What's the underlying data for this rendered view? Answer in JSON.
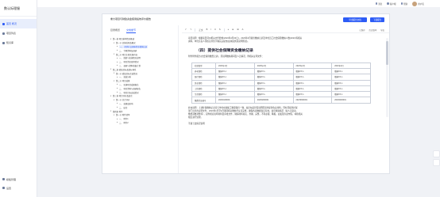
{
  "app": {
    "title": "数认标理服"
  },
  "sidebar": {
    "items": [
      {
        "label": "首页 概况"
      },
      {
        "label": "项目列表"
      },
      {
        "label": "知识库"
      }
    ],
    "bottom": [
      {
        "label": "模板管理"
      },
      {
        "label": "设置"
      }
    ]
  },
  "topbar": {
    "items": [
      "消息",
      "客户端",
      "帮助"
    ],
    "user": "用户名"
  },
  "window": {
    "title": "重大项目与财政资金使用绩效评价报告",
    "primary_button": "导出报告文档",
    "secondary_button": "下载报告"
  },
  "left_tabs": [
    "目录概览",
    "文档章节"
  ],
  "outline": [
    {
      "label": "第一章 项目基本情况概述",
      "level": 0,
      "caret": "▾"
    },
    {
      "label": "第一节 实施背景及概况",
      "level": 1,
      "caret": "▾"
    },
    {
      "label": "一、 提供社会保障资金缴纳记录",
      "level": 2,
      "caret": "▸",
      "selected": true
    },
    {
      "label": "二、 专题资料及调研",
      "level": 2,
      "caret": "▸"
    },
    {
      "label": "第二节 项目主要实施内容",
      "level": 1,
      "caret": "▾"
    },
    {
      "label": "一、 组织与实施情况说明",
      "level": 2,
      "caret": "▸"
    },
    {
      "label": "二、 项目资金使用情况",
      "level": 2,
      "caret": "▸"
    },
    {
      "label": "三、 调研与资料收集计划",
      "level": 2,
      "caret": "▸"
    },
    {
      "label": "第二章 绩效目标及指标体系",
      "level": 0,
      "caret": "▾"
    },
    {
      "label": "第一节 绩效目标完成情况",
      "level": 1,
      "caret": "▾"
    },
    {
      "label": "一、 效益分析",
      "level": 2,
      "caret": "▸"
    },
    {
      "label": "第二节 项目成果",
      "level": 1,
      "caret": "▾"
    },
    {
      "label": "一、 实施项目成果报告",
      "level": 2,
      "caret": "▸"
    },
    {
      "label": "二、 项目资料与调研报告",
      "level": 2,
      "caret": "▸"
    },
    {
      "label": "三、 项目目标达成情况",
      "level": 2,
      "caret": "▸"
    },
    {
      "label": "第三章 项目评价及结论",
      "level": 0,
      "caret": "▾"
    },
    {
      "label": "第一节 综合评价",
      "level": 1,
      "caret": "▾"
    },
    {
      "label": "一、 效果及影响",
      "level": 2,
      "caret": "▸"
    },
    {
      "label": "二、 结论",
      "level": 2,
      "caret": "▸"
    },
    {
      "label": "第四章 附件",
      "level": 0,
      "caret": "▾"
    },
    {
      "label": "第一节 附件清单",
      "level": 1,
      "caret": "▾"
    },
    {
      "label": "一、 附件1",
      "level": 2,
      "caret": "▸"
    },
    {
      "label": "二、 附件2",
      "level": 2,
      "caret": "▸"
    }
  ],
  "editor_toolbar": {
    "items": [
      "↶",
      "↷",
      "正文",
      "B",
      "I",
      "U",
      "S",
      "≡",
      "☰",
      "⊞",
      "A"
    ],
    "right": [
      "已保存",
      "历史版本",
      "导出"
    ]
  },
  "document": {
    "intro_lines": [
      "项目说明：根据项目评价相关文件要求(2023年4月20日)，2023年4月提供缴纳记录及单位员工社会保障缴纳人数(2023)等相关",
      "资料，单位负责人须核实并签字确认后提交(如未提供需说明原因)。"
    ],
    "heading": "（四）提供社会保障资金缴纳记录",
    "subline": "附件附件报告(社会保险缴费记录)，须说明缴纳期间及人员情况，附相关证明文件：",
    "table_header": [
      "社保类型",
      "2023年1月",
      "2023年2月",
      "2023年3月",
      "2023年4月"
    ],
    "table_rows": [
      [
        "养老保险",
        "缴纳XX人",
        "缴纳XX人",
        "缴纳XX人",
        "缴纳XX人"
      ],
      [
        "医疗保险",
        "缴纳XX人",
        "缴纳XX人",
        "缴纳XX人",
        "缴纳XX人"
      ],
      [
        "失业保险",
        "缴纳XX人",
        "缴纳XX人",
        "缴纳XX人",
        "缴纳XX人"
      ],
      [
        "工伤保险",
        "缴纳XX人",
        "缴纳XX人",
        "缴纳XX人",
        "缴纳XX人"
      ],
      [
        "生育保险",
        "缴纳XX人",
        "缴纳XX人",
        "缴纳XX人",
        "缴纳XX人"
      ],
      [
        "缴费凭证编号",
        "20230100001",
        "20230200001",
        "20230300001",
        "20230400001"
      ]
    ],
    "after_lines": [
      "补充说明：上述社保缴纳记录应与单位在职职工数量保持一致，如存在差异需说明原因并提供佐证材料。同时须提供社保",
      "部门出具的证明文件，2023年1月至4月期间相关缴纳凭证应完整，确保各项数据真实有效。如有特殊情况（如人员变动、",
      "缴费基数调整等），应附相应说明材料及审批文件，确保材料真实、准确、完整，不得虚报、瞒报。如发现弄虚作假，将按相关",
      "规定进行处理。"
    ],
    "footer_line": "不属于此情况说明"
  }
}
